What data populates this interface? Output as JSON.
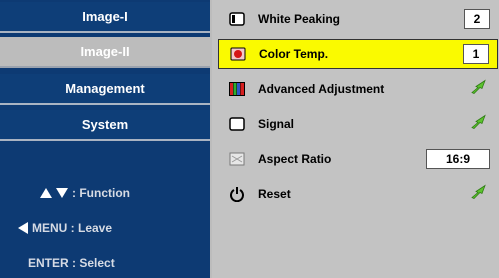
{
  "sidebar": {
    "tabs": [
      {
        "label": "Image-I"
      },
      {
        "label": "Image-II"
      },
      {
        "label": "Management"
      },
      {
        "label": "System"
      }
    ],
    "hints": {
      "function": ": Function",
      "menu_leave": "MENU : Leave",
      "enter_select": "ENTER : Select"
    }
  },
  "items": {
    "white_peaking": {
      "label": "White Peaking",
      "value": "2",
      "icon": "frame-icon"
    },
    "color_temp": {
      "label": "Color Temp.",
      "value": "1",
      "icon": "thermometer-icon"
    },
    "advanced_adjustment": {
      "label": "Advanced Adjustment",
      "icon": "color-bars-icon"
    },
    "signal": {
      "label": "Signal",
      "icon": "frame-icon"
    },
    "aspect_ratio": {
      "label": "Aspect Ratio",
      "value": "16:9",
      "icon": "screen-icon"
    },
    "reset": {
      "label": "Reset",
      "icon": "power-icon"
    }
  },
  "colors": {
    "sidebar_bg": "#0d3a73",
    "panel_bg": "#c3c3c3",
    "selection": "#fafa00",
    "enter_arrow": "#5cc32e"
  }
}
